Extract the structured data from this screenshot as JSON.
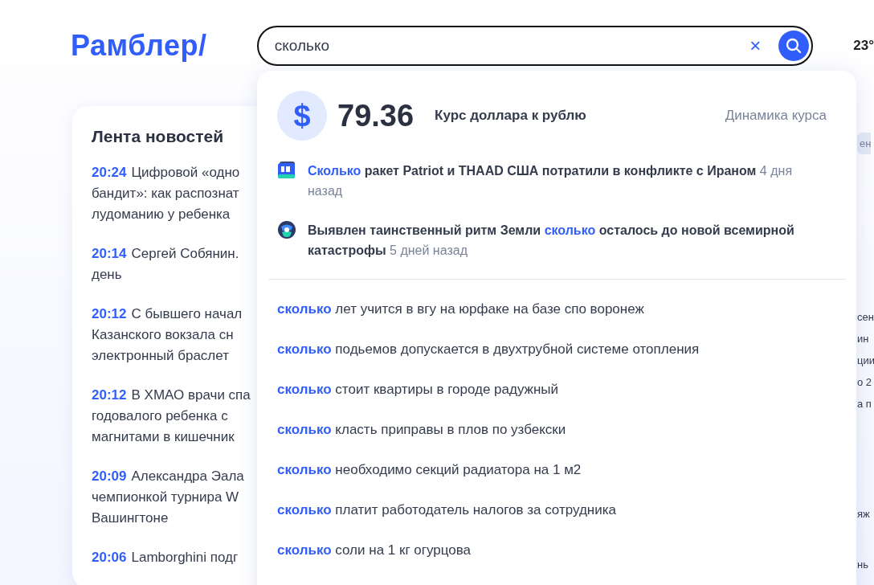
{
  "logo": "Рамблер/",
  "search": {
    "value": "сколько",
    "clear": "×"
  },
  "weather": "23°",
  "feed": {
    "title": "Лента новостей",
    "items": [
      {
        "time": "20:24",
        "lines": [
          "Цифровой «одно",
          "бандит»: как распознат",
          "лудоманию у ребенка"
        ]
      },
      {
        "time": "20:14",
        "lines": [
          "Сергей Собянин.",
          "день"
        ]
      },
      {
        "time": "20:12",
        "lines": [
          "С бывшего начал",
          "Казанского вокзала сн",
          "электронный браслет"
        ]
      },
      {
        "time": "20:12",
        "lines": [
          "В ХМАО врачи спа",
          "годовалого ребенка с ",
          "магнитами в кишечник"
        ]
      },
      {
        "time": "20:09",
        "lines": [
          "Александра Эала",
          "чемпионкой турнира W",
          "Вашингтоне"
        ]
      },
      {
        "time": "20:06",
        "lines": [
          "Lamborghini подг"
        ]
      }
    ]
  },
  "right_fragments": [
    {
      "text": "ен",
      "kind": "tab"
    },
    {
      "text": "сен",
      "kind": "line"
    },
    {
      "text": "ин",
      "kind": "line"
    },
    {
      "text": "ции",
      "kind": "line"
    },
    {
      "text": "о 2",
      "kind": "line"
    },
    {
      "text": "а п",
      "kind": "line"
    },
    {
      "text": "яж",
      "kind": "line"
    },
    {
      "text": "нь",
      "kind": "line"
    }
  ],
  "dropdown": {
    "rate": {
      "symbol": "$",
      "value": "79.36",
      "label": "Курс доллара к рублю",
      "link": "Динамика курса"
    },
    "news": [
      {
        "kind": "tv",
        "parts": [
          {
            "text": "Сколько",
            "highlight": true
          },
          {
            "text": " ракет Patriot и THAAD США потратили в конфликте с Ираном",
            "highlight": false
          }
        ],
        "age": "4 дня назад"
      },
      {
        "kind": "globe",
        "parts": [
          {
            "text": "Выявлен таинственный ритм Земли ",
            "highlight": false
          },
          {
            "text": "сколько",
            "highlight": true
          },
          {
            "text": " осталось до новой всемирной катастрофы",
            "highlight": false
          }
        ],
        "age": "5 дней назад"
      }
    ],
    "suggestions": [
      {
        "query": "сколько",
        "rest": " лет учится в вгу на юрфаке на базе спо воронеж"
      },
      {
        "query": "сколько",
        "rest": " подьемов допускается в двухтрубной системе отопления"
      },
      {
        "query": "сколько",
        "rest": " стоит квартиры в городе радужный"
      },
      {
        "query": "сколько",
        "rest": " класть приправы в плов по узбекски"
      },
      {
        "query": "сколько",
        "rest": " необходимо секций радиатора на 1 м2"
      },
      {
        "query": "сколько",
        "rest": " платит работодатель налогов за сотрудника"
      },
      {
        "query": "сколько",
        "rest": " соли на 1 кг огурцова"
      }
    ]
  }
}
